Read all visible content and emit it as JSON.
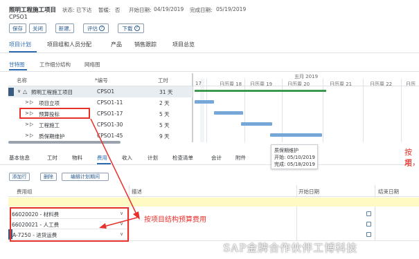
{
  "header": {
    "title": "照明工程施工项目",
    "subtitle": "CPSO1",
    "status_label": "状态:",
    "status_value": "已下达",
    "suspended_label": "暂缓:",
    "suspended_value": "否",
    "planned_date_label": "开始日期:",
    "planned_date": "04/19/2019",
    "finish_date_label": "完成日期:",
    "finish_date": "05/19/2019"
  },
  "toolbar": {
    "save": "保存",
    "close": "关闭",
    "new": "新建,",
    "evaluate": "评估",
    "download": "下载"
  },
  "main_tabs": [
    "项目计划",
    "项目组和人员分配",
    "产品",
    "销售跟踪",
    "项目总览"
  ],
  "view_tabs": [
    "甘特图",
    "工作细分结构",
    "网络图"
  ],
  "gantt": {
    "col_name": "名称",
    "col_code": "*编号",
    "col_days": "工时",
    "month": "五月 2019",
    "days": [
      "17",
      "日历周 18",
      "日历周 19",
      "日历周 20",
      "日历周 21",
      "日历周 22",
      "日历"
    ],
    "rows": [
      {
        "name": "照明工程施工项目",
        "code": "CPSO1",
        "days": "31 天"
      },
      {
        "name": "项目立项",
        "code": "CPSO1-11",
        "days": "2 天"
      },
      {
        "name": "预算投标",
        "code": "CPSO1-17",
        "days": "5 天"
      },
      {
        "name": "工程施工",
        "code": "CPSO1-30",
        "days": "5 天"
      },
      {
        "name": "质保期维护",
        "code": "CPSO1-45",
        "days": "9 天"
      }
    ],
    "tooltip": {
      "title": "质保期维护",
      "start": "开始: 05/10/2019",
      "finish": "完成: 05/18/2019"
    }
  },
  "detail_tabs": [
    "基本信息",
    "工时",
    "物料",
    "费用",
    "收入",
    "计划",
    "检查清单",
    "会计",
    "附件"
  ],
  "detail_buttons": {
    "add_row": "添加行",
    "delete": "删除",
    "edit_plan": "编辑计划期间"
  },
  "cost_table": {
    "col_group": "费用组",
    "col_desc": "描述",
    "col_start": "开始日期",
    "col_end": "结束日期",
    "items": [
      "66020020 - 材料费",
      "66020021 - 人工费",
      "A-7250 - 进货运费"
    ]
  },
  "annotations": {
    "budget": "按项目结构预算费用",
    "side_1": "按项",
    "side_2": "用，",
    "watermark": "SAP金牌合作伙伴工博科技"
  },
  "colors": {
    "accent": "#2d6cb0",
    "red": "#e8302b",
    "bar": "#77a6d9",
    "progress": "#3a9a4e",
    "yellow": "#fff9c4"
  }
}
